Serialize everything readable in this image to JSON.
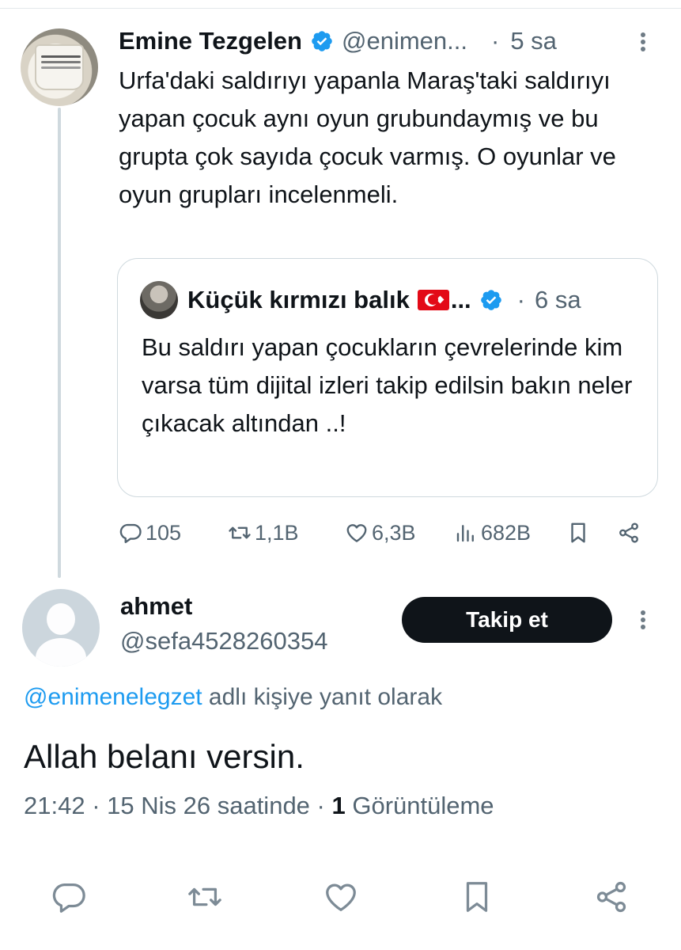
{
  "parent_tweet": {
    "author_name": "Emine Tezgelen",
    "handle": "@enimen...",
    "dot": "·",
    "time": "5 sa",
    "text": "Urfa'daki saldırıyı yapanla Maraş'taki saldırıyı yapan çocuk aynı oyun grubundaymış ve bu grupta çok sayıda çocuk varmış. O oyunlar ve oyun grupları incelenmeli.",
    "quoted": {
      "author_name": "Küçük kırmızı balık",
      "ellipsis": "...",
      "dot": "·",
      "time": "6 sa",
      "text": "Bu saldırı yapan çocukların çevrelerinde kim varsa tüm dijital izleri takip edilsin bakın neler çıkacak altından ..!"
    },
    "actions": {
      "replies": "105",
      "reposts": "1,1B",
      "likes": "6,3B",
      "views": "682B"
    }
  },
  "reply": {
    "author_name": "ahmet",
    "handle": "@sefa4528260354",
    "follow_label": "Takip et",
    "reply_to_mention": "@enimenelegzet",
    "reply_to_suffix": " adlı kişiye yanıt olarak",
    "text": "Allah belanı versin.",
    "time": "21:42",
    "sep1": " · ",
    "date": "15 Nis 26 saatinde",
    "sep2": " · ",
    "views_count": "1",
    "views_label": " Görüntüleme"
  },
  "colors": {
    "accent": "#1d9bf0",
    "secondary_text": "#536471",
    "primary_text": "#0f1419",
    "border": "#cfd9de"
  },
  "icons": [
    "verified-badge-icon",
    "more-icon",
    "reply-icon",
    "repost-icon",
    "like-icon",
    "views-icon",
    "bookmark-icon",
    "share-icon",
    "turkish-flag-emoji"
  ]
}
